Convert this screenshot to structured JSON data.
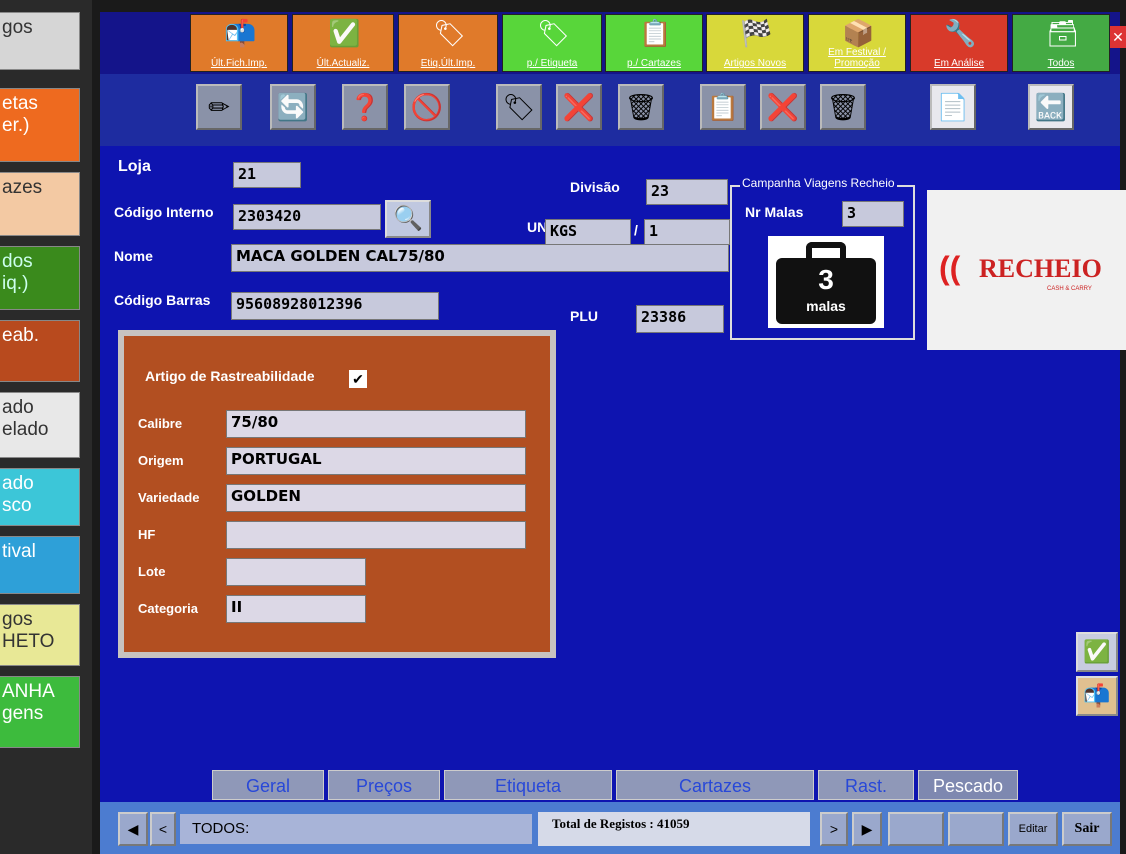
{
  "sidebar": {
    "items": [
      {
        "label": "gos",
        "bg": "#d6d6d6",
        "fg": "#333"
      },
      {
        "label": "etas\ner.)",
        "bg": "#ee6a1f",
        "fg": "#fff"
      },
      {
        "label": "azes",
        "bg": "#f3c9a3",
        "fg": "#333"
      },
      {
        "label": "dos\niq.)",
        "bg": "#3a8a1c",
        "fg": "#cfe"
      },
      {
        "label": "eab.",
        "bg": "#b84a1e",
        "fg": "#fff"
      },
      {
        "label": "ado\nelado",
        "bg": "#e8e8e8",
        "fg": "#333"
      },
      {
        "label": "ado\nsco",
        "bg": "#3cc6d8",
        "fg": "#fff"
      },
      {
        "label": "tival",
        "bg": "#2ea0d8",
        "fg": "#fff"
      },
      {
        "label": "gos\nHETO",
        "bg": "#e8e896",
        "fg": "#333"
      },
      {
        "label": "ANHA\ngens",
        "bg": "#3dbb3d",
        "fg": "#fff"
      }
    ]
  },
  "toolbar_top": [
    {
      "label": "Últ.Fich.Imp.",
      "bg": "#e07a2a",
      "icon": "📬"
    },
    {
      "label": "Últ.Actualiz.",
      "bg": "#e07a2a",
      "icon": "✅"
    },
    {
      "label": "Etiq.Últ.Imp.",
      "bg": "#e07a2a",
      "icon": "🏷"
    },
    {
      "label": "p./ Etiqueta",
      "bg": "#58d63a",
      "icon": "🏷"
    },
    {
      "label": "p./ Cartazes",
      "bg": "#58d63a",
      "icon": "📋"
    },
    {
      "label": "Artigos Novos",
      "bg": "#d8d83a",
      "icon": "🏁"
    },
    {
      "label": "Em Festival / Promoção",
      "bg": "#d8d83a",
      "icon": "📦"
    },
    {
      "label": "Em Análise",
      "bg": "#d83a2a",
      "icon": "🔧"
    },
    {
      "label": "Todos",
      "bg": "#44aa44",
      "icon": "🗃"
    }
  ],
  "toolbar_2": [
    {
      "icon": "✏",
      "name": "edit-icon"
    },
    {
      "icon": "🔄",
      "name": "refresh-icon"
    },
    {
      "icon": "❓",
      "name": "help-icon"
    },
    {
      "icon": "🚫",
      "name": "remove-icon"
    },
    {
      "icon": "🏷",
      "name": "label-icon"
    },
    {
      "icon": "❌",
      "name": "delete-label-icon"
    },
    {
      "icon": "🗑",
      "name": "trash-icon"
    },
    {
      "icon": "📋",
      "name": "poster-icon"
    },
    {
      "icon": "❌",
      "name": "delete-poster-icon"
    },
    {
      "icon": "🗑",
      "name": "trash-2-icon"
    },
    {
      "icon": "📄",
      "name": "document-icon"
    },
    {
      "icon": "🔙",
      "name": "back-icon"
    }
  ],
  "form": {
    "loja_label": "Loja",
    "loja_value": "21",
    "codigo_interno_label": "Código Interno",
    "codigo_interno_value": "2303420",
    "nome_label": "Nome",
    "nome_value": "MACA GOLDEN CAL75/80",
    "codigo_barras_label": "Código Barras",
    "codigo_barras_value": "95608928012396",
    "divisao_label": "Divisão",
    "divisao_value": "23",
    "un_label": "UN",
    "un_value": "KGS",
    "un_slash": "/",
    "un_qty": "1",
    "plu_label": "PLU",
    "plu_value": "23386"
  },
  "campaign": {
    "title": "Campanha Viagens Recheio",
    "nr_malas_label": "Nr Malas",
    "nr_malas_value": "3",
    "badge_number": "3",
    "badge_text": "malas"
  },
  "logo": {
    "text": "RECHEIO",
    "sub": "CASH & CARRY"
  },
  "trace": {
    "title": "Artigo de Rastreabilidade",
    "checked": "✔",
    "fields": [
      {
        "label": "Calibre",
        "value": "75/80"
      },
      {
        "label": "Origem",
        "value": "PORTUGAL"
      },
      {
        "label": "Variedade",
        "value": "GOLDEN"
      },
      {
        "label": "HF",
        "value": ""
      },
      {
        "label": "Lote",
        "value": ""
      },
      {
        "label": "Categoria",
        "value": "II"
      }
    ]
  },
  "tabs": [
    "Geral",
    "Preços",
    "Etiqueta",
    "Cartazes",
    "Rast.",
    "Pescado"
  ],
  "statusbar": {
    "filter_value": "TODOS:",
    "total_text": "Total de Registos : 41059",
    "edit_label": "Editar",
    "exit_label": "Sair"
  },
  "colors": {
    "window": "#0e14b0",
    "trace_panel": "#b24f21"
  }
}
